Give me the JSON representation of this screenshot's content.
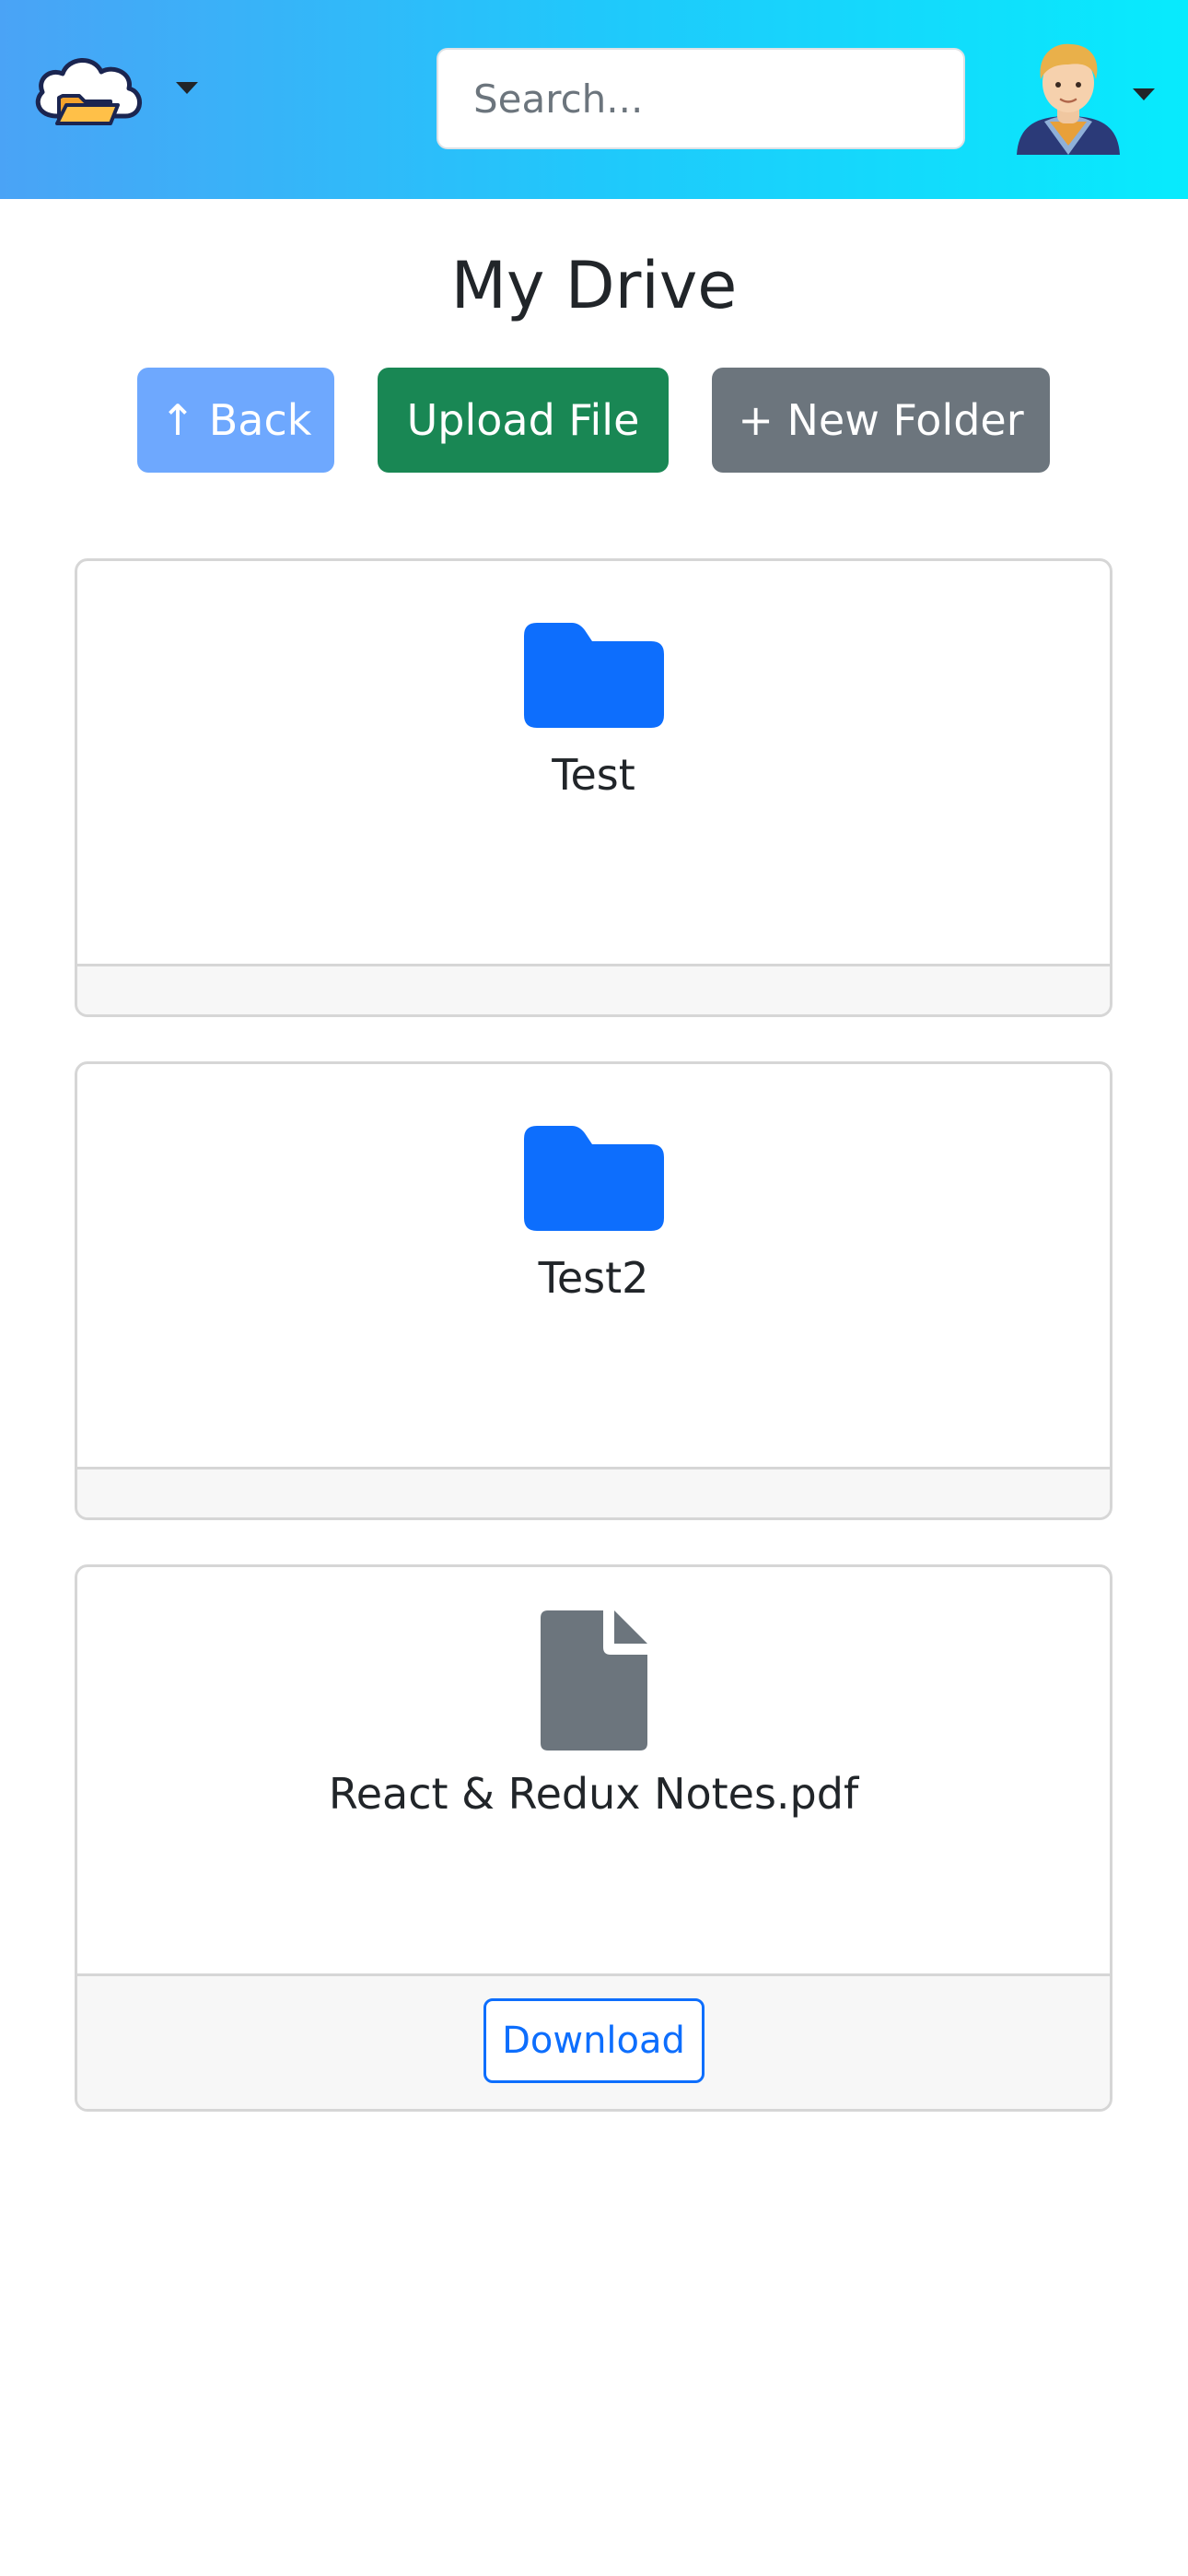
{
  "header": {
    "search_placeholder": "Search..."
  },
  "page": {
    "title": "My Drive"
  },
  "toolbar": {
    "back_label": "↑ Back",
    "upload_label": "Upload File",
    "new_folder_label": "+ New Folder"
  },
  "items": [
    {
      "type": "folder",
      "name": "Test",
      "icon": "folder-icon"
    },
    {
      "type": "folder",
      "name": "Test2",
      "icon": "folder-icon"
    },
    {
      "type": "file",
      "name": "React & Redux Notes.pdf",
      "icon": "file-icon",
      "action_label": "Download"
    }
  ],
  "colors": {
    "folder": "#0d6efd",
    "file": "#6c757d",
    "back": "#6ea8fe",
    "upload": "#198754",
    "new_folder": "#6c757d"
  }
}
